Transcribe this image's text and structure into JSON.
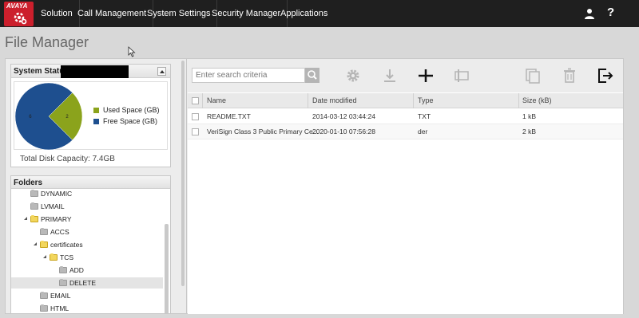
{
  "nav": {
    "logo_text": "AVAYA",
    "items": [
      "Solution",
      "Call Management",
      "System Settings",
      "Security Manager",
      "Applications"
    ],
    "user_icon": "user-icon",
    "help_icon": "help-icon"
  },
  "page": {
    "title": "File Manager"
  },
  "system_status": {
    "title": "System Status",
    "chart_data": {
      "type": "pie",
      "slices": [
        {
          "name": "Used Space (GB)",
          "value": 2,
          "label": "2",
          "color": "#8ba31c"
        },
        {
          "name": "Free Space (GB)",
          "value": 6,
          "label": "6",
          "color": "#1e4f8f"
        }
      ]
    },
    "capacity_text": "Total Disk Capacity: 7.4GB"
  },
  "folders": {
    "title": "Folders",
    "items": [
      {
        "label": "DYNAMIC",
        "depth": 1,
        "expanded": false,
        "color": "gray"
      },
      {
        "label": "LVMAIL",
        "depth": 1,
        "expanded": false,
        "color": "gray"
      },
      {
        "label": "PRIMARY",
        "depth": 1,
        "expanded": true,
        "color": "yellow"
      },
      {
        "label": "ACCS",
        "depth": 2,
        "expanded": false,
        "color": "gray"
      },
      {
        "label": "certificates",
        "depth": 2,
        "expanded": true,
        "color": "yellow"
      },
      {
        "label": "TCS",
        "depth": 3,
        "expanded": true,
        "color": "yellow"
      },
      {
        "label": "ADD",
        "depth": 4,
        "expanded": false,
        "color": "gray"
      },
      {
        "label": "DELETE",
        "depth": 4,
        "expanded": false,
        "color": "gray",
        "selected": true
      },
      {
        "label": "EMAIL",
        "depth": 2,
        "expanded": false,
        "color": "gray"
      },
      {
        "label": "HTML",
        "depth": 2,
        "expanded": false,
        "color": "gray"
      }
    ]
  },
  "toolbar": {
    "search_placeholder": "Enter search criteria",
    "icons": [
      "search-icon",
      "gear-icon",
      "download-icon",
      "add-icon",
      "rename-icon",
      "copy-icon",
      "trash-icon",
      "exit-icon"
    ]
  },
  "table": {
    "columns": [
      "Name",
      "Date modified",
      "Type",
      "Size (kB)"
    ],
    "rows": [
      [
        "README.TXT",
        "2014-03-12 03:44:24",
        "TXT",
        "1 kB"
      ],
      [
        "VeriSign Class 3 Public Primary Ce...",
        "2020-01-10 07:56:28",
        "der",
        "2 kB"
      ]
    ]
  }
}
